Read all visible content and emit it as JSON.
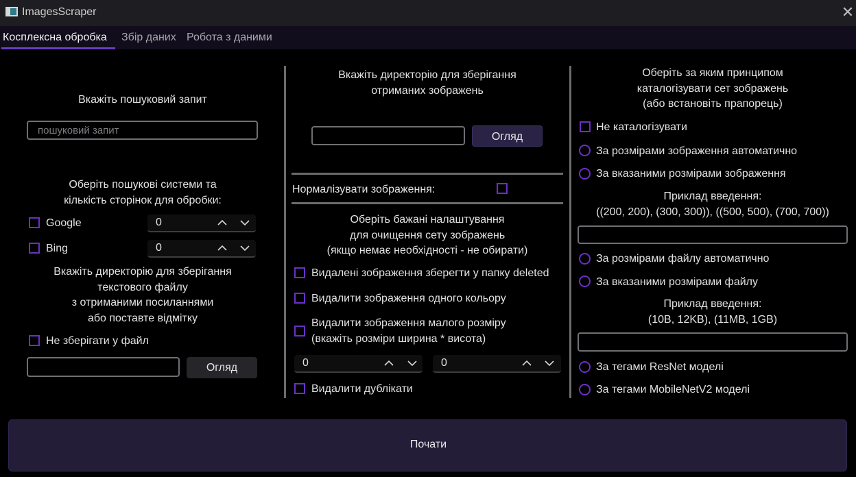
{
  "window": {
    "title": "ImagesScraper"
  },
  "tabs": [
    "Косплексна обробка",
    "Збір даних",
    "Робота з даними"
  ],
  "left": {
    "query_label": "Вкажіть пошуковий запит",
    "query_placeholder": "пошуковий запит",
    "engines_label_line1": "Оберіть пошукові системи та",
    "engines_label_line2": "кількість сторінок для обробки:",
    "engines": [
      {
        "name": "Google",
        "pages": "0"
      },
      {
        "name": "Bing",
        "pages": "0"
      }
    ],
    "dir_label_line1": "Вкажіть директорію для зберігання",
    "dir_label_line2": "текстового файлу",
    "dir_label_line3": "з отриманими посиланнями",
    "dir_label_line4": "або поставте відмітку",
    "no_save_label": "Не зберігати у файл",
    "browse_label": "Огляд"
  },
  "middle": {
    "dir_label_line1": "Вкажіть директорію для зберігання",
    "dir_label_line2": "отриманих зображень",
    "browse_label": "Огляд",
    "normalize_label": "Нормалізувати зображення:",
    "clean_label_line1": "Оберіть бажані налаштування",
    "clean_label_line2": "для очищення сету зображень",
    "clean_label_line3": "(якщо немає необхідності - не обирати)",
    "save_deleted_label": "Видалені зображення зберегти у папку deleted",
    "delete_single_color_label": "Видалити зображення одного кольору",
    "delete_small_label_line1": "Видалити зображення малого розміру",
    "delete_small_label_line2": "(вкажіть розміри ширина * висота)",
    "width_value": "0",
    "height_value": "0",
    "delete_duplicates_label": "Видалити дублікати"
  },
  "right": {
    "catalog_label_line1": "Оберіть за яким принципом",
    "catalog_label_line2": "каталогізувати сет зображень",
    "catalog_label_line3": "(або встановіть прапорець)",
    "no_catalog_label": "Не каталогізувати",
    "by_image_size_auto": "За розмірами зображення автоматично",
    "by_image_size_given": "За вказаними розмірами зображення",
    "image_example_title": "Приклад введення:",
    "image_example_value": "((200, 200), (300, 300)), ((500, 500), (700, 700))",
    "by_file_size_auto": "За розмірами файлу автоматично",
    "by_file_size_given": "За вказаними розмірами файлу",
    "file_example_title": "Приклад введення:",
    "file_example_value": "(10B, 12KB), (11MB, 1GB)",
    "by_resnet": "За тегами ResNet моделі",
    "by_mobilenet": "За тегами MobileNetV2 моделі"
  },
  "start_label": "Почати",
  "colors": {
    "accent": "#6b2fc8",
    "background": "#000000",
    "button": "#241d38"
  }
}
